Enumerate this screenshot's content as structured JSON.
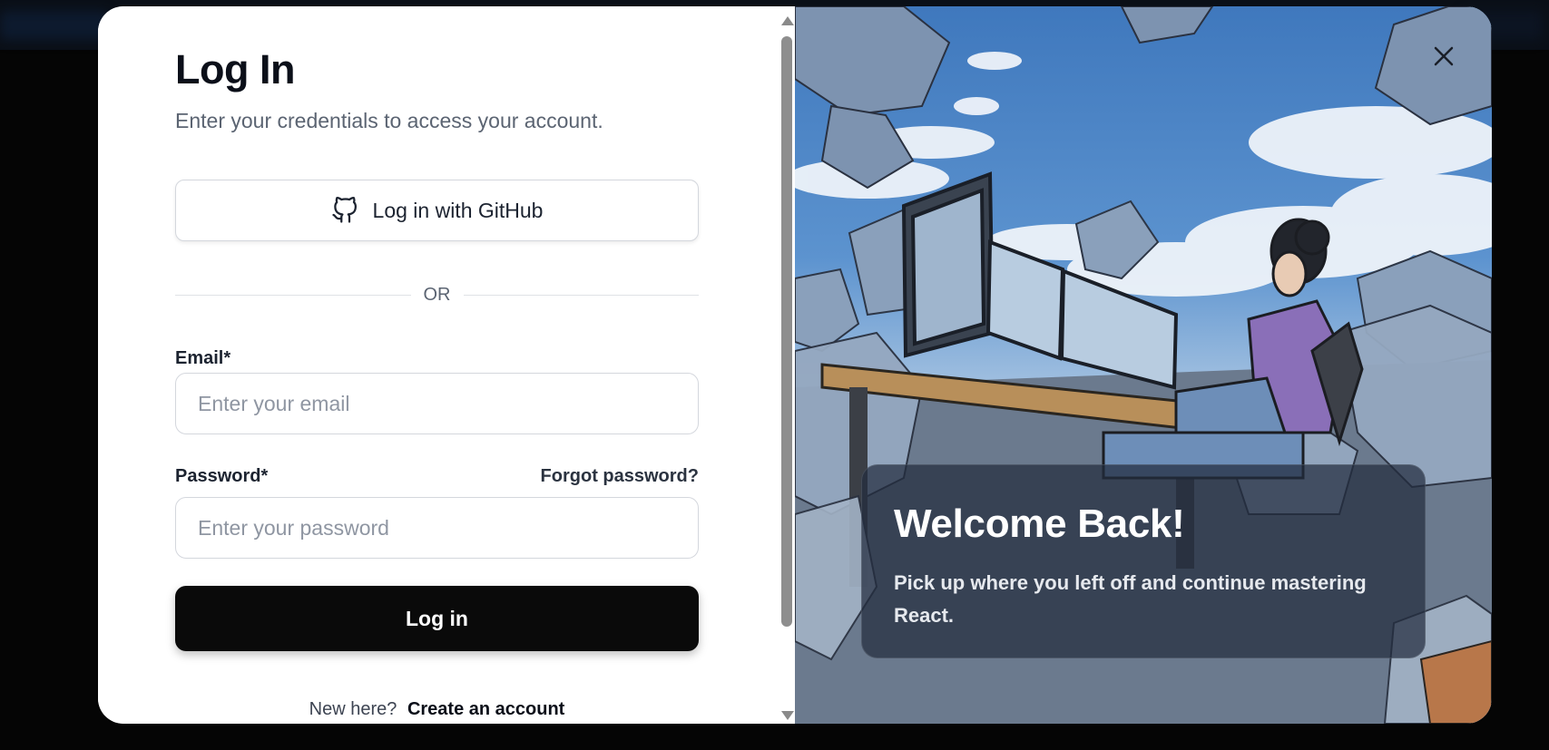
{
  "login": {
    "title": "Log In",
    "subtitle": "Enter your credentials to access your account.",
    "github_button": "Log in with GitHub",
    "divider_text": "OR",
    "email": {
      "label": "Email*",
      "placeholder": "Enter your email",
      "value": ""
    },
    "password": {
      "label": "Password*",
      "placeholder": "Enter your password",
      "value": "",
      "forgot_link": "Forgot password?"
    },
    "submit_label": "Log in",
    "footer": {
      "prompt": "New here?",
      "link": "Create an account"
    }
  },
  "welcome": {
    "heading": "Welcome Back!",
    "body": "Pick up where you left off and continue mastering React."
  },
  "icons": {
    "github": "github-icon",
    "close": "close-icon"
  },
  "colors": {
    "primary_button": "#0a0a0a",
    "overlay": "#050505",
    "sky": "#4f86c6"
  }
}
